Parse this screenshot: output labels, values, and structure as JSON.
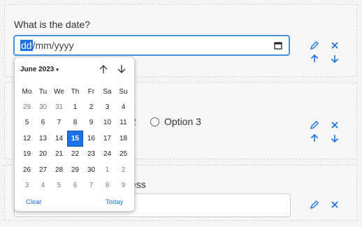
{
  "cards": [
    {
      "question": "What is the date?",
      "date_input": {
        "day": "dd",
        "rest": "/mm/yyyy"
      }
    },
    {
      "option_partial": "2",
      "option3": "Option 3"
    },
    {
      "question_partial": "ess"
    }
  ],
  "calendar": {
    "month_label": "June 2023",
    "caret": "▾",
    "weekdays": [
      "Mo",
      "Tu",
      "We",
      "Th",
      "Fr",
      "Sa",
      "Su"
    ],
    "days": [
      {
        "t": "29",
        "m": true
      },
      {
        "t": "30",
        "m": true
      },
      {
        "t": "31",
        "m": true
      },
      {
        "t": "1"
      },
      {
        "t": "2"
      },
      {
        "t": "3"
      },
      {
        "t": "4"
      },
      {
        "t": "5"
      },
      {
        "t": "6"
      },
      {
        "t": "7"
      },
      {
        "t": "8"
      },
      {
        "t": "9"
      },
      {
        "t": "10"
      },
      {
        "t": "11"
      },
      {
        "t": "12"
      },
      {
        "t": "13"
      },
      {
        "t": "14"
      },
      {
        "t": "15",
        "s": true
      },
      {
        "t": "16"
      },
      {
        "t": "17"
      },
      {
        "t": "18"
      },
      {
        "t": "19"
      },
      {
        "t": "20"
      },
      {
        "t": "21"
      },
      {
        "t": "22"
      },
      {
        "t": "23"
      },
      {
        "t": "24"
      },
      {
        "t": "25"
      },
      {
        "t": "26"
      },
      {
        "t": "27"
      },
      {
        "t": "28"
      },
      {
        "t": "29"
      },
      {
        "t": "30"
      },
      {
        "t": "1",
        "m": true
      },
      {
        "t": "2",
        "m": true
      },
      {
        "t": "3",
        "m": true
      },
      {
        "t": "4",
        "m": true
      },
      {
        "t": "5",
        "m": true
      },
      {
        "t": "6",
        "m": true
      },
      {
        "t": "7",
        "m": true
      },
      {
        "t": "8",
        "m": true
      },
      {
        "t": "9",
        "m": true
      }
    ],
    "clear_label": "Clear",
    "today_label": "Today"
  },
  "colors": {
    "accent": "#1a73e8",
    "tool_icon": "#1a73e8"
  },
  "icons": [
    "calendar-icon",
    "pencil-icon",
    "close-icon",
    "arrow-up-icon",
    "arrow-down-icon"
  ]
}
